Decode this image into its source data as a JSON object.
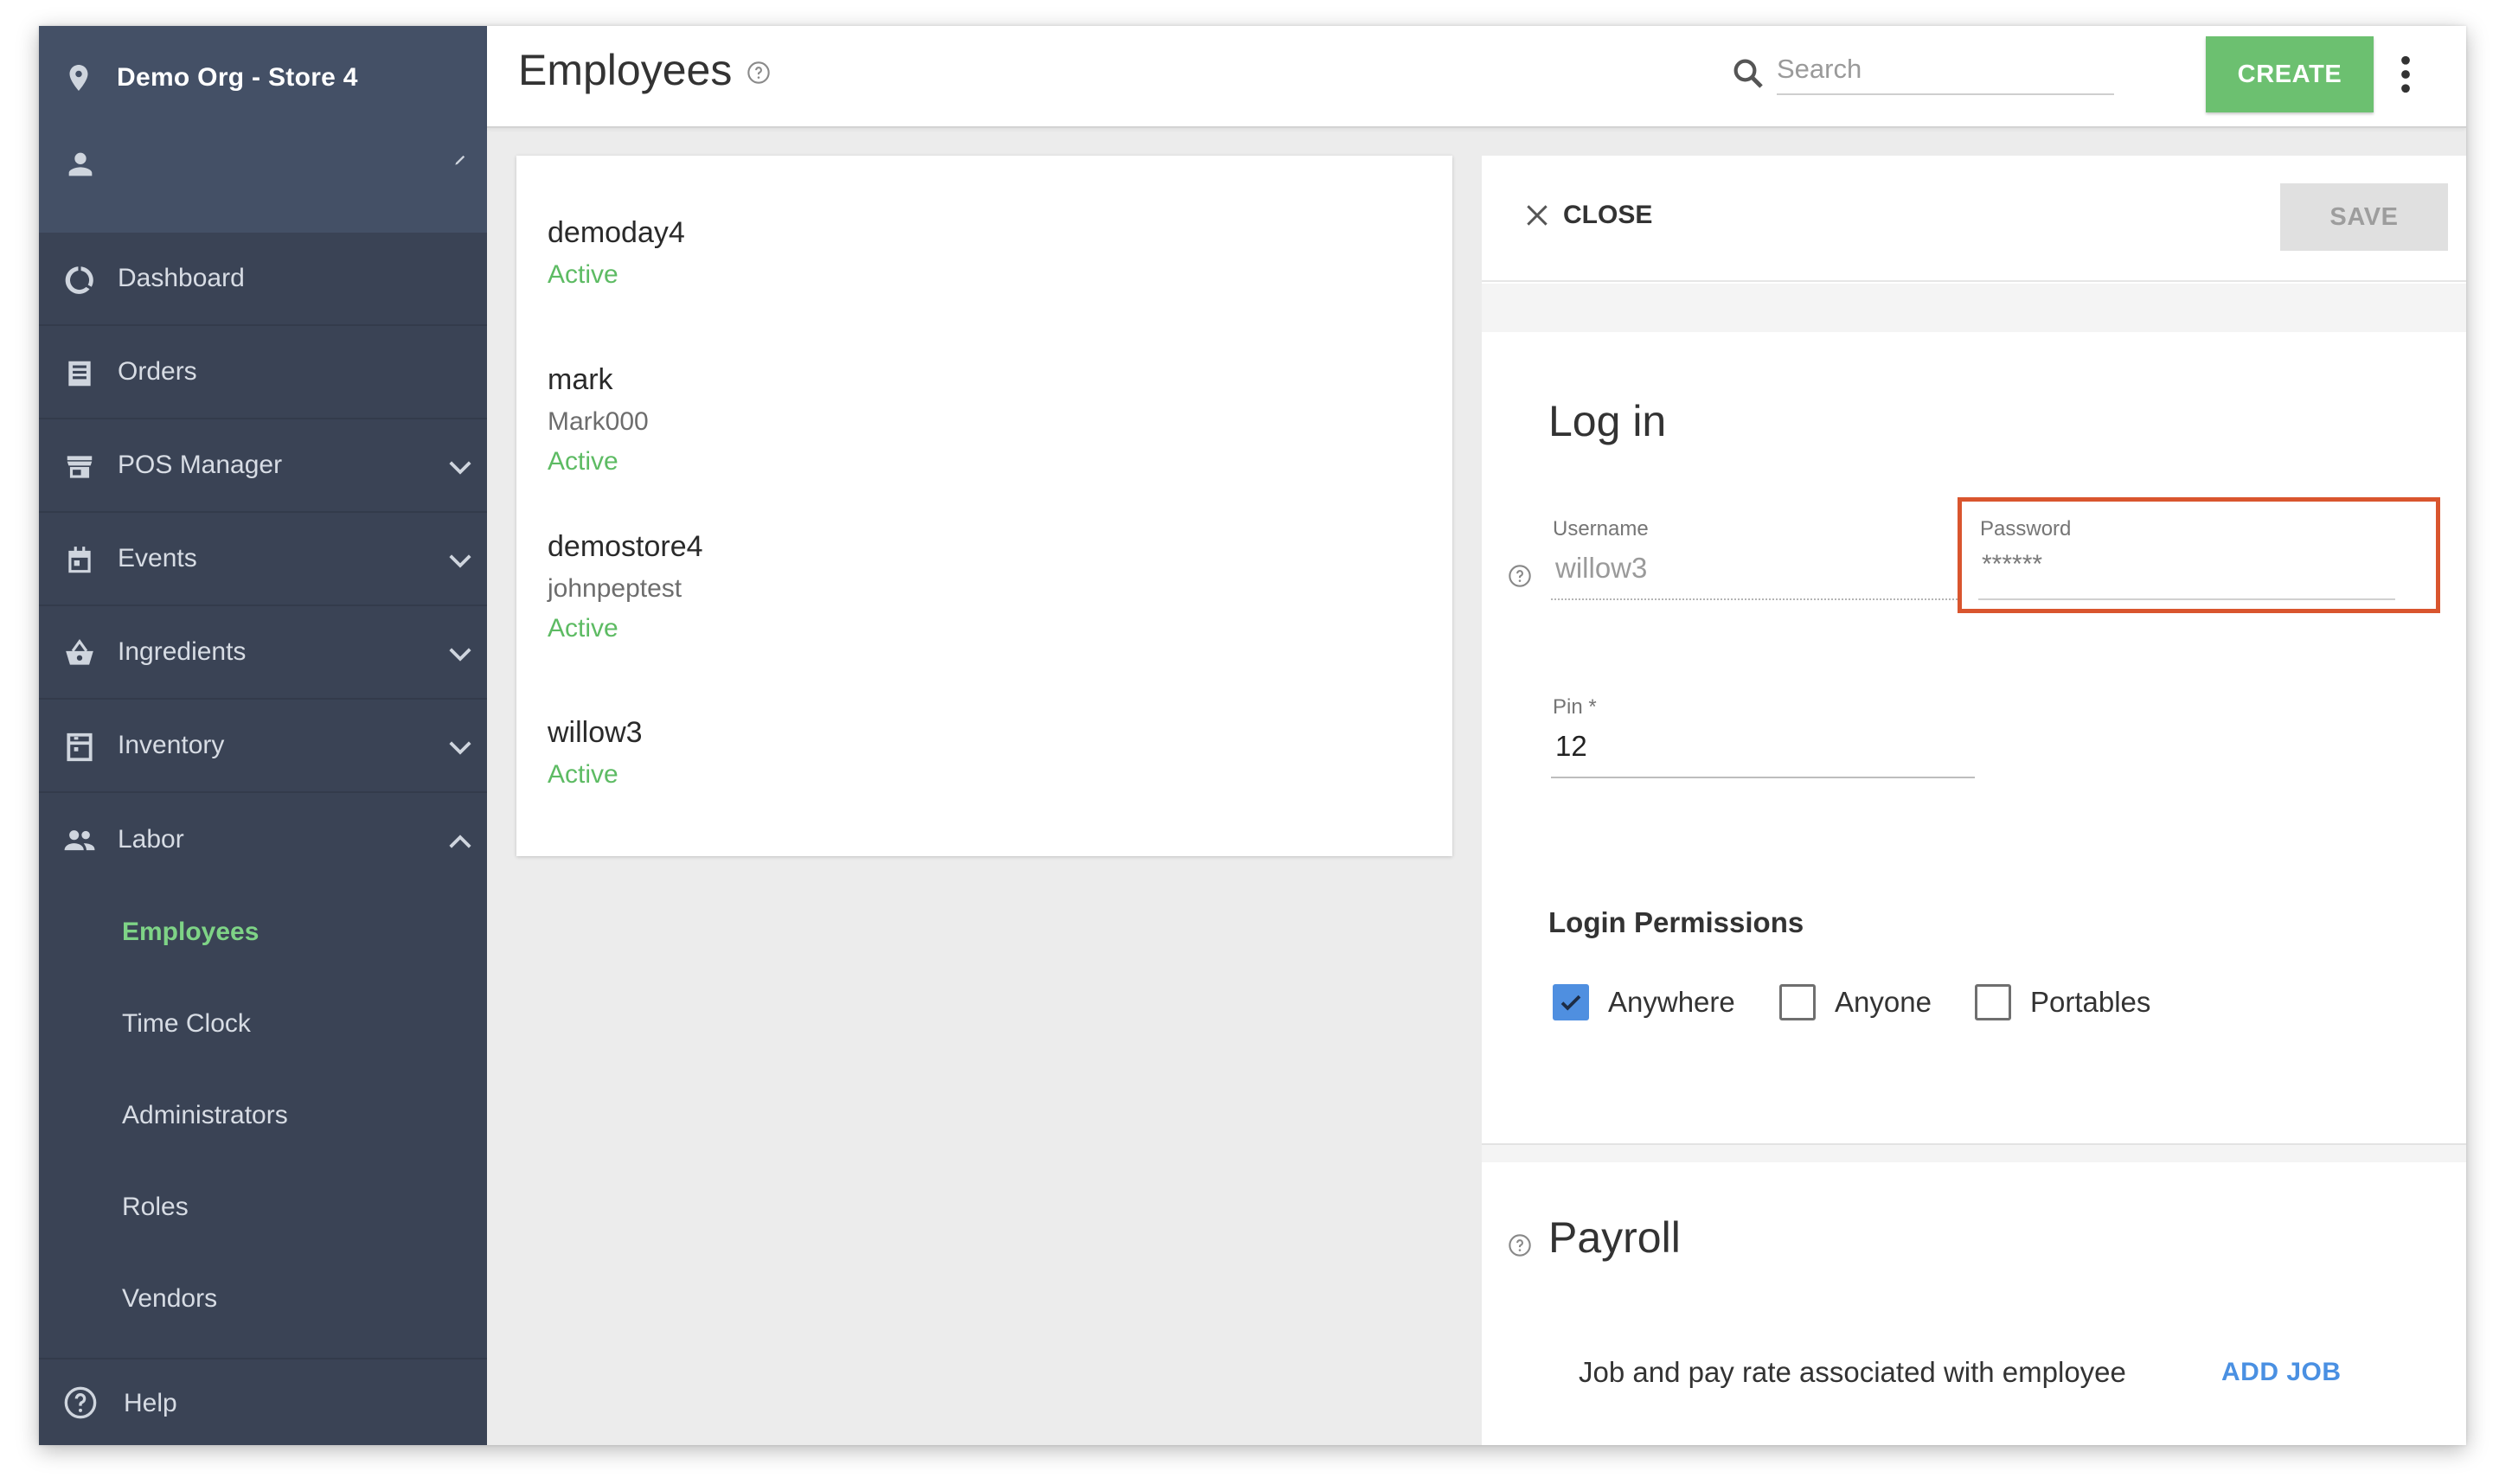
{
  "sidebar": {
    "store_name": "Demo Org - Store 4",
    "nav": [
      {
        "label": "Dashboard",
        "icon": "dashboard-icon"
      },
      {
        "label": "Orders",
        "icon": "orders-icon"
      },
      {
        "label": "POS Manager",
        "icon": "store-icon",
        "expandable": true
      },
      {
        "label": "Events",
        "icon": "calendar-icon",
        "expandable": true
      },
      {
        "label": "Ingredients",
        "icon": "basket-icon",
        "expandable": true
      },
      {
        "label": "Inventory",
        "icon": "inventory-icon",
        "expandable": true
      },
      {
        "label": "Labor",
        "icon": "people-icon",
        "expanded": true
      }
    ],
    "labor_sub": [
      "Employees",
      "Time Clock",
      "Administrators",
      "Roles",
      "Vendors"
    ],
    "active_sub": "Employees",
    "help_label": "Help"
  },
  "topbar": {
    "title": "Employees",
    "search_placeholder": "Search",
    "create_label": "CREATE"
  },
  "employees": [
    {
      "name": "demoday4",
      "subtitle": "",
      "status": "Active"
    },
    {
      "name": "mark",
      "subtitle": "Mark000",
      "status": "Active"
    },
    {
      "name": "demostore4",
      "subtitle": "johnpeptest",
      "status": "Active"
    },
    {
      "name": "willow3",
      "subtitle": "",
      "status": "Active"
    }
  ],
  "detail": {
    "close_label": "CLOSE",
    "save_label": "SAVE",
    "login": {
      "title": "Log in",
      "username_label": "Username",
      "username_value": "willow3",
      "password_label": "Password",
      "password_value": "******",
      "pin_label": "Pin *",
      "pin_value": "12"
    },
    "permissions": {
      "title": "Login Permissions",
      "options": [
        {
          "label": "Anywhere",
          "checked": true
        },
        {
          "label": "Anyone",
          "checked": false
        },
        {
          "label": "Portables",
          "checked": false
        }
      ]
    },
    "payroll": {
      "title": "Payroll",
      "description": "Job and pay rate associated with employee",
      "add_job_label": "ADD JOB"
    }
  },
  "colors": {
    "sidebar_bg": "#3a4355",
    "sidebar_header_bg": "#445066",
    "active_green": "#7ed386",
    "status_green": "#5dbb63",
    "create_green": "#6cc070",
    "checkbox_blue": "#4f8fe0",
    "highlight_red": "#d9552e",
    "link_blue": "#4a90e2"
  }
}
